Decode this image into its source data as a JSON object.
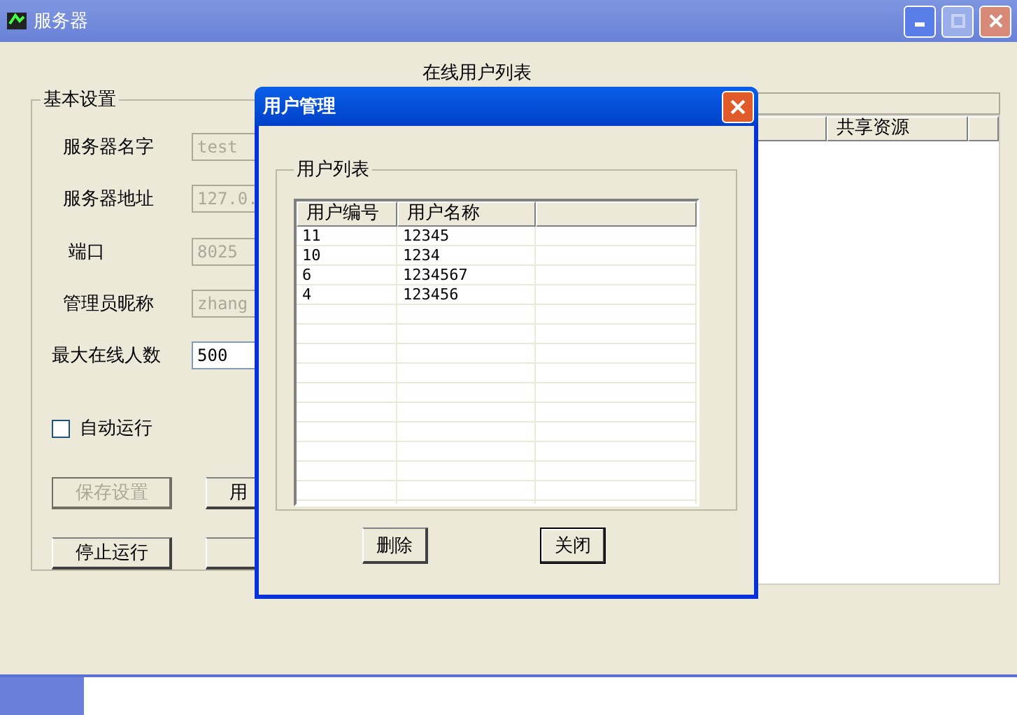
{
  "window": {
    "title": "服务器"
  },
  "settings": {
    "legend": "基本设置",
    "fields": [
      {
        "label": "服务器名字",
        "value": "test",
        "disabled": true
      },
      {
        "label": "服务器地址",
        "value": "127.0.",
        "disabled": true
      },
      {
        "label": "端口",
        "value": "8025",
        "disabled": true
      },
      {
        "label": "管理员昵称",
        "value": "zhang",
        "disabled": true
      },
      {
        "label": "最大在线人数",
        "value": "500",
        "disabled": false
      }
    ],
    "auto_run": {
      "label": "自动运行",
      "checked": false
    },
    "buttons": [
      {
        "label": "保存设置",
        "disabled": true
      },
      {
        "label": "用",
        "disabled": false
      },
      {
        "label": "停止运行",
        "disabled": false
      },
      {
        "disabled": false
      }
    ]
  },
  "online": {
    "legend": "在线用户列表",
    "columns": [
      "共享资源"
    ]
  },
  "dialog": {
    "title": "用户管理",
    "group": "用户列表",
    "columns": [
      "用户编号",
      "用户名称"
    ],
    "rows": [
      [
        "11",
        "12345"
      ],
      [
        "10",
        "1234"
      ],
      [
        "6",
        "1234567"
      ],
      [
        "4",
        "123456"
      ]
    ],
    "buttons": [
      {
        "label": "删除",
        "focused": false
      },
      {
        "label": "关闭",
        "focused": true
      }
    ]
  }
}
